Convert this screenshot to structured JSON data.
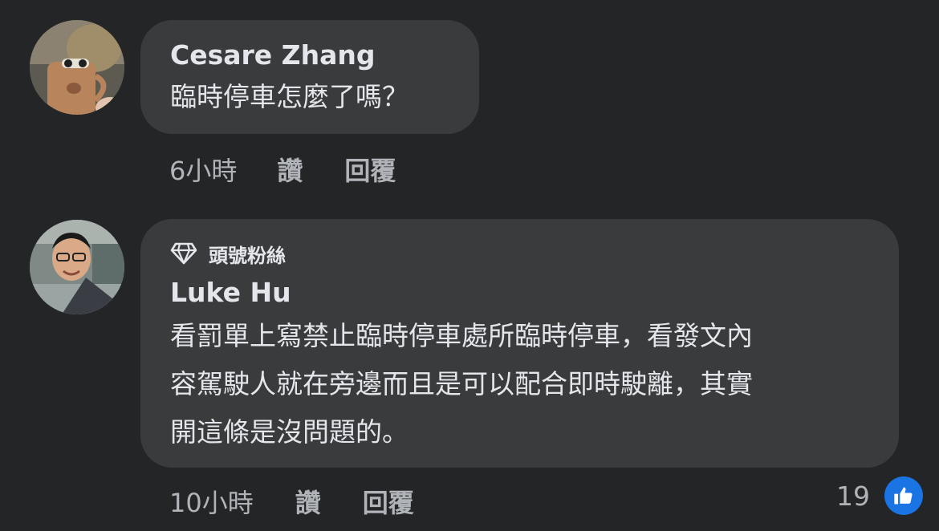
{
  "comments": [
    {
      "author": "Cesare Zhang",
      "text": "臨時停車怎麼了嗎？",
      "time": "6小時",
      "like_label": "讚",
      "reply_label": "回覆"
    },
    {
      "badge": "頭號粉絲",
      "author": "Luke Hu",
      "text_lines": [
        "看罰單上寫禁止臨時停車處所臨時停車，看發文內",
        "容駕駛人就在旁邊而且是可以配合即時駛離，其實",
        "開這條是沒問題的。"
      ],
      "time": "10小時",
      "like_label": "讚",
      "reply_label": "回覆",
      "reaction_count": "19"
    }
  ],
  "colors": {
    "background": "#242526",
    "bubble": "#3a3b3c",
    "text": "#e4e6eb",
    "secondary": "#b0b3b8",
    "like_blue": "#1b74e4"
  },
  "icons": {
    "badge": "diamond-icon",
    "reaction": "thumbs-up-icon"
  }
}
